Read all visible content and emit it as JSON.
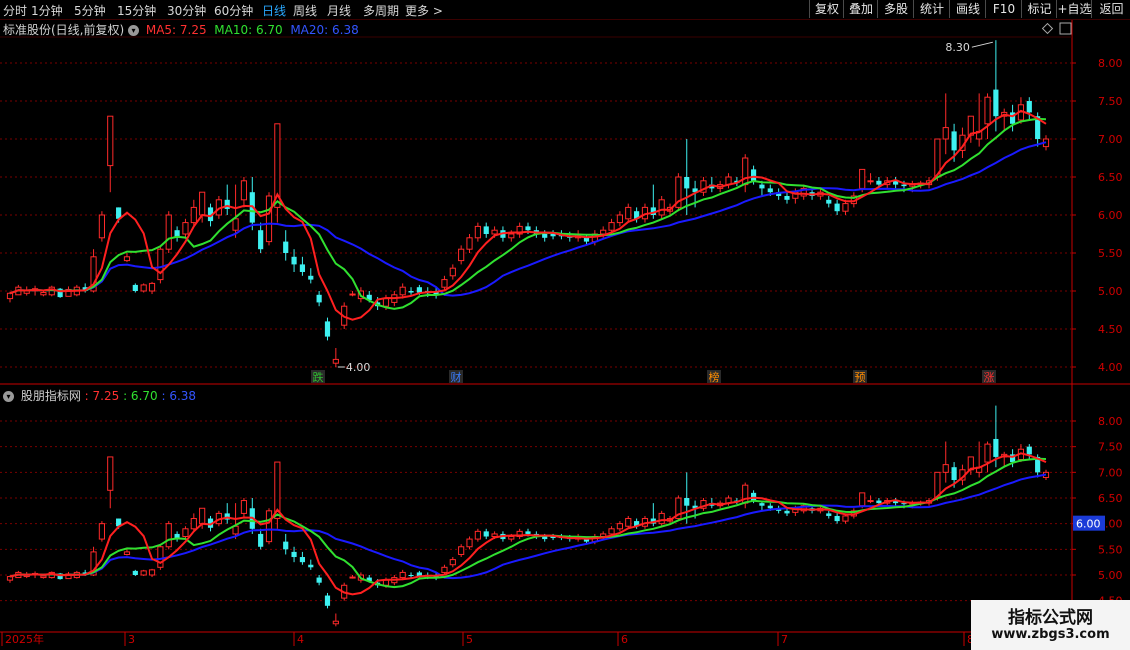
{
  "toolbar": {
    "periods": [
      "分时",
      "1分钟",
      "5分钟",
      "15分钟",
      "30分钟",
      "60分钟",
      "日线",
      "周线",
      "月线",
      "多周期",
      "更多 >"
    ],
    "active_period": "日线",
    "right_buttons": [
      "复权",
      "叠加",
      "多股",
      "统计",
      "画线",
      "F10",
      "标记",
      "+自选",
      "返回"
    ]
  },
  "main_panel": {
    "title": "标准股份(日线,前复权)",
    "ma5_label": "MA5: 7.25",
    "ma10_label": "MA10: 6.70",
    "ma20_label": "MA20: 6.38",
    "high_annotation": "8.30",
    "low_annotation": "4.00",
    "price_ticks": [
      "8.00",
      "7.50",
      "7.00",
      "6.50",
      "6.00",
      "5.50",
      "5.00",
      "4.50",
      "4.00"
    ],
    "markers": [
      {
        "text": "跌",
        "color": "#2fbf2f"
      },
      {
        "text": "财",
        "color": "#3a7dff"
      },
      {
        "text": "榜",
        "color": "#ff8c00"
      },
      {
        "text": "预",
        "color": "#ff8c00"
      },
      {
        "text": "涨",
        "color": "#ff3030"
      }
    ]
  },
  "sub_panel": {
    "title": "股朋指标网",
    "val1": ": 7.25",
    "val2": ": 6.70",
    "val3": ": 6.38",
    "price_ticks": [
      "8.00",
      "7.50",
      "7.00",
      "6.50",
      "6.00",
      "5.50",
      "5.00",
      "4.50"
    ],
    "cursor_price": "6.00"
  },
  "time_axis": {
    "labels": [
      "2025年",
      "3",
      "4",
      "5",
      "6",
      "7",
      "8"
    ]
  },
  "watermark": {
    "line1": "指标公式网",
    "line2": "www.zbgs3.com"
  },
  "colors": {
    "up": "#ff2a2a",
    "down": "#3ef0f0",
    "ma5": "#ff2020",
    "ma10": "#30e030",
    "ma20": "#1a1aff",
    "grid": "#7a0000",
    "axis": "#c80000"
  },
  "chart_data": {
    "type": "candlestick",
    "series": [
      {
        "name": "MA5",
        "value": 7.25
      },
      {
        "name": "MA10",
        "value": 6.7
      },
      {
        "name": "MA20",
        "value": 6.38
      }
    ],
    "ylim": [
      3.9,
      8.5
    ],
    "period_high": 8.3,
    "period_low": 4.0,
    "candles": [
      [
        4.9,
        4.97,
        4.85,
        4.99
      ],
      [
        4.95,
        5.05,
        4.95,
        5.08
      ],
      [
        4.97,
        5.0,
        4.94,
        5.06
      ],
      [
        5.0,
        5.03,
        4.94,
        5.07
      ],
      [
        4.95,
        4.98,
        4.93,
        5.02
      ],
      [
        4.95,
        5.05,
        4.93,
        5.07
      ],
      [
        5.03,
        4.92,
        4.91,
        5.04
      ],
      [
        4.93,
        5.02,
        4.93,
        5.06
      ],
      [
        4.95,
        5.05,
        4.93,
        5.08
      ],
      [
        5.05,
        5.0,
        4.98,
        5.1
      ],
      [
        5.0,
        5.45,
        4.98,
        5.55
      ],
      [
        5.7,
        6.0,
        5.65,
        6.05
      ],
      [
        6.65,
        7.3,
        6.3,
        7.3
      ],
      [
        6.1,
        5.95,
        5.9,
        6.1
      ],
      [
        5.4,
        5.45,
        5.38,
        5.5
      ],
      [
        5.08,
        5.0,
        4.98,
        5.1
      ],
      [
        5.0,
        5.08,
        4.98,
        5.1
      ],
      [
        5.0,
        5.1,
        4.96,
        5.12
      ],
      [
        5.15,
        5.55,
        5.1,
        5.6
      ],
      [
        5.55,
        6.0,
        5.5,
        6.05
      ],
      [
        5.8,
        5.7,
        5.65,
        5.85
      ],
      [
        5.75,
        5.9,
        5.7,
        5.95
      ],
      [
        5.9,
        6.1,
        5.85,
        6.2
      ],
      [
        6.0,
        6.3,
        5.9,
        6.3
      ],
      [
        6.1,
        5.92,
        5.85,
        6.15
      ],
      [
        6.0,
        6.2,
        5.95,
        6.25
      ],
      [
        6.2,
        6.08,
        6.0,
        6.4
      ],
      [
        5.8,
        5.95,
        5.7,
        6.4
      ],
      [
        6.2,
        6.45,
        6.1,
        6.5
      ],
      [
        6.3,
        5.9,
        5.8,
        6.5
      ],
      [
        5.8,
        5.55,
        5.5,
        5.9
      ],
      [
        5.65,
        6.25,
        5.6,
        6.3
      ],
      [
        6.1,
        7.2,
        5.9,
        7.2
      ],
      [
        5.65,
        5.5,
        5.4,
        5.8
      ],
      [
        5.45,
        5.35,
        5.25,
        5.55
      ],
      [
        5.35,
        5.25,
        5.2,
        5.45
      ],
      [
        5.2,
        5.15,
        5.1,
        5.3
      ],
      [
        4.95,
        4.85,
        4.8,
        5.0
      ],
      [
        4.6,
        4.4,
        4.35,
        4.65
      ],
      [
        4.05,
        4.1,
        4.0,
        4.25
      ],
      [
        4.55,
        4.8,
        4.5,
        4.85
      ],
      [
        4.95,
        4.96,
        4.93,
        5.0
      ],
      [
        4.9,
        5.0,
        4.85,
        5.05
      ],
      [
        4.95,
        4.88,
        4.85,
        5.0
      ],
      [
        4.85,
        4.8,
        4.75,
        4.92
      ],
      [
        4.8,
        4.9,
        4.75,
        4.95
      ],
      [
        4.85,
        4.95,
        4.8,
        5.0
      ],
      [
        4.95,
        5.05,
        4.9,
        5.1
      ],
      [
        5.0,
        4.98,
        4.95,
        5.05
      ],
      [
        5.05,
        4.98,
        4.95,
        5.08
      ],
      [
        5.0,
        4.97,
        4.92,
        5.05
      ],
      [
        5.0,
        4.96,
        4.9,
        5.05
      ],
      [
        5.05,
        5.15,
        5.0,
        5.2
      ],
      [
        5.2,
        5.3,
        5.15,
        5.35
      ],
      [
        5.4,
        5.55,
        5.35,
        5.6
      ],
      [
        5.55,
        5.7,
        5.5,
        5.75
      ],
      [
        5.7,
        5.85,
        5.65,
        5.9
      ],
      [
        5.85,
        5.75,
        5.7,
        5.9
      ],
      [
        5.75,
        5.8,
        5.7,
        5.85
      ],
      [
        5.8,
        5.7,
        5.65,
        5.85
      ],
      [
        5.7,
        5.75,
        5.65,
        5.8
      ],
      [
        5.75,
        5.85,
        5.7,
        5.9
      ],
      [
        5.85,
        5.8,
        5.75,
        5.9
      ],
      [
        5.8,
        5.75,
        5.7,
        5.85
      ],
      [
        5.75,
        5.7,
        5.65,
        5.8
      ],
      [
        5.75,
        5.72,
        5.68,
        5.8
      ],
      [
        5.75,
        5.72,
        5.68,
        5.8
      ],
      [
        5.72,
        5.7,
        5.65,
        5.78
      ],
      [
        5.7,
        5.75,
        5.65,
        5.8
      ],
      [
        5.7,
        5.65,
        5.6,
        5.75
      ],
      [
        5.65,
        5.75,
        5.6,
        5.8
      ],
      [
        5.75,
        5.8,
        5.7,
        5.85
      ],
      [
        5.8,
        5.9,
        5.75,
        5.95
      ],
      [
        5.9,
        6.0,
        5.85,
        6.05
      ],
      [
        5.95,
        6.1,
        5.9,
        6.15
      ],
      [
        6.05,
        5.95,
        5.9,
        6.1
      ],
      [
        5.95,
        6.1,
        5.9,
        6.15
      ],
      [
        6.1,
        6.0,
        5.95,
        6.4
      ],
      [
        6.0,
        6.2,
        5.95,
        6.25
      ],
      [
        6.05,
        6.1,
        6.0,
        6.15
      ],
      [
        6.1,
        6.5,
        6.05,
        6.55
      ],
      [
        6.5,
        6.35,
        6.0,
        7.0
      ],
      [
        6.35,
        6.3,
        6.1,
        6.45
      ],
      [
        6.3,
        6.45,
        6.25,
        6.5
      ],
      [
        6.4,
        6.35,
        6.3,
        6.5
      ],
      [
        6.35,
        6.4,
        6.3,
        6.45
      ],
      [
        6.4,
        6.5,
        6.35,
        6.55
      ],
      [
        6.45,
        6.42,
        6.38,
        6.5
      ],
      [
        6.4,
        6.75,
        6.3,
        6.8
      ],
      [
        6.6,
        6.45,
        6.4,
        6.65
      ],
      [
        6.4,
        6.35,
        6.25,
        6.45
      ],
      [
        6.35,
        6.3,
        6.25,
        6.4
      ],
      [
        6.3,
        6.25,
        6.2,
        6.35
      ],
      [
        6.25,
        6.2,
        6.15,
        6.3
      ],
      [
        6.22,
        6.3,
        6.15,
        6.35
      ],
      [
        6.25,
        6.35,
        6.2,
        6.4
      ],
      [
        6.3,
        6.25,
        6.2,
        6.35
      ],
      [
        6.25,
        6.3,
        6.2,
        6.35
      ],
      [
        6.2,
        6.15,
        6.1,
        6.25
      ],
      [
        6.15,
        6.05,
        6.0,
        6.2
      ],
      [
        6.05,
        6.15,
        6.0,
        6.2
      ],
      [
        6.15,
        6.25,
        6.1,
        6.3
      ],
      [
        6.35,
        6.6,
        6.3,
        6.6
      ],
      [
        6.45,
        6.45,
        6.4,
        6.55
      ],
      [
        6.45,
        6.4,
        6.35,
        6.5
      ],
      [
        6.4,
        6.45,
        6.35,
        6.5
      ],
      [
        6.45,
        6.4,
        6.35,
        6.5
      ],
      [
        6.4,
        6.38,
        6.3,
        6.45
      ],
      [
        6.38,
        6.4,
        6.3,
        6.45
      ],
      [
        6.4,
        6.42,
        6.35,
        6.45
      ],
      [
        6.4,
        6.45,
        6.35,
        6.5
      ],
      [
        6.5,
        7.0,
        6.45,
        7.0
      ],
      [
        7.0,
        7.15,
        6.8,
        7.6
      ],
      [
        7.1,
        6.85,
        6.7,
        7.2
      ],
      [
        6.85,
        7.05,
        6.75,
        7.15
      ],
      [
        7.05,
        7.3,
        6.95,
        7.3
      ],
      [
        7.0,
        7.1,
        6.9,
        7.6
      ],
      [
        7.2,
        7.55,
        7.0,
        7.6
      ],
      [
        7.65,
        7.3,
        7.1,
        8.3
      ],
      [
        7.3,
        7.35,
        7.1,
        7.4
      ],
      [
        7.35,
        7.2,
        7.1,
        7.45
      ],
      [
        7.25,
        7.45,
        7.2,
        7.55
      ],
      [
        7.5,
        7.35,
        7.25,
        7.55
      ],
      [
        7.3,
        7.0,
        6.9,
        7.35
      ],
      [
        6.9,
        7.0,
        6.85,
        7.05
      ]
    ]
  }
}
